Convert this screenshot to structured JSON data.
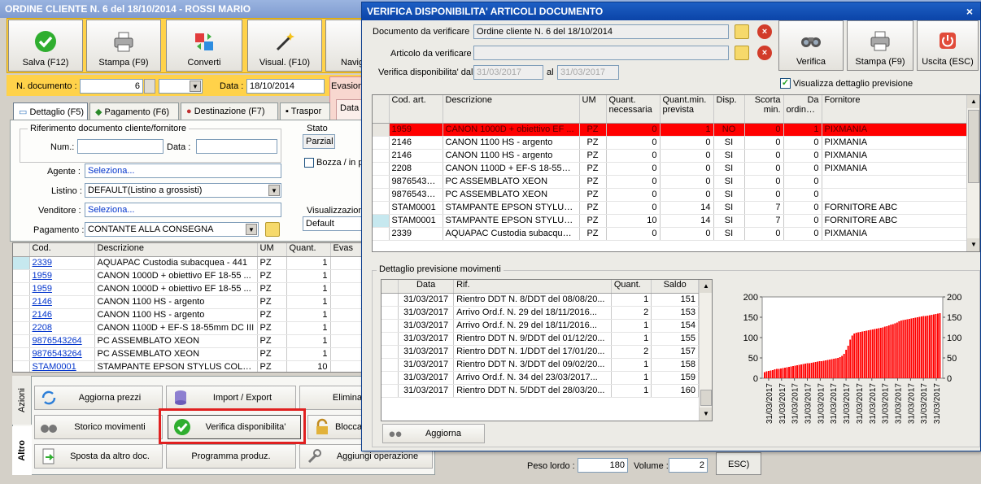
{
  "bg_window": {
    "title": "ORDINE CLIENTE N. 6 del 18/10/2014 - ROSSI MARIO",
    "toolbar": [
      "Salva (F12)",
      "Stampa (F9)",
      "Converti",
      "Visual. (F10)",
      "Navig"
    ],
    "ndoc_label": "N. documento :",
    "ndoc_value": "6",
    "data_label": "Data :",
    "data_value": "18/10/2014",
    "evasion_label": "Evasion",
    "tabs": [
      "Dettaglio (F5)",
      "Pagamento (F6)",
      "Destinazione (F7)",
      "Traspor"
    ],
    "rif_group": "Riferimento documento cliente/fornitore",
    "num_label": "Num.:",
    "data2_label": "Data :",
    "stato_label": "Stato",
    "stato_value": "Parzial",
    "bozza_label": "Bozza / in p",
    "data_box": "Data",
    "agente_label": "Agente :",
    "agente_value": "Seleziona...",
    "listino_label": "Listino :",
    "listino_value": "DEFAULT(Listino a grossisti)",
    "venditore_label": "Venditore :",
    "venditore_value": "Seleziona...",
    "pagamento_label": "Pagamento :",
    "pagamento_value": "CONTANTE ALLA CONSEGNA",
    "visual_label": "Visualizzazione",
    "visual_value": "Default",
    "grid_headers": [
      "Cod.",
      "Descrizione",
      "UM",
      "Quant.",
      "Evas"
    ],
    "grid_rows": [
      [
        "2339",
        "AQUAPAC Custodia subacquea - 441",
        "PZ",
        "1"
      ],
      [
        "1959",
        "CANON 1000D + obiettivo EF 18-55 ...",
        "PZ",
        "1"
      ],
      [
        "1959",
        "CANON 1000D + obiettivo EF 18-55 ...",
        "PZ",
        "1"
      ],
      [
        "2146",
        "CANON 1100 HS - argento",
        "PZ",
        "1"
      ],
      [
        "2146",
        "CANON 1100 HS - argento",
        "PZ",
        "1"
      ],
      [
        "2208",
        "CANON 1100D + EF-S 18-55mm DC III",
        "PZ",
        "1"
      ],
      [
        "9876543264",
        "PC ASSEMBLATO XEON",
        "PZ",
        "1"
      ],
      [
        "9876543264",
        "PC ASSEMBLATO XEON",
        "PZ",
        "1"
      ],
      [
        "STAM0001",
        "STAMPANTE EPSON STYLUS COLOR C...",
        "PZ",
        "10"
      ]
    ],
    "side_tabs": [
      "Azioni",
      "Altro"
    ],
    "actions": [
      "Aggiorna prezzi",
      "Import / Export",
      "Elimina",
      "Storico movimenti",
      "Verifica disponibilita'",
      "Blocca",
      "Sposta da altro doc.",
      "Programma produz.",
      "Aggiungi operazione"
    ],
    "peso_label": "Peso lordo :",
    "peso_value": "180",
    "volume_label": "Volume :",
    "volume_value": "2",
    "esc_fragment": "ESC)"
  },
  "dialog": {
    "title": "VERIFICA DISPONIBILITA' ARTICOLI DOCUMENTO",
    "close": "×",
    "doc_label": "Documento da verificare",
    "doc_value": "Ordine cliente N. 6 del 18/10/2014",
    "art_label": "Articolo da verificare",
    "art_value": "",
    "disp_label": "Verifica disponibilita' dal",
    "date_from": "31/03/2017",
    "al_label": "al",
    "date_to": "31/03/2017",
    "buttons": [
      "Verifica",
      "Stampa (F9)",
      "Uscita (ESC)"
    ],
    "checkbox_label": "Visualizza dettaglio previsione",
    "checkbox_checked": true,
    "headers": [
      "Cod. art.",
      "Descrizione",
      "UM",
      "Quant. necessaria",
      "Quant.min. prevista",
      "Disp.",
      "Scorta min.",
      "Da ordinare",
      "Fornitore"
    ],
    "rows": [
      [
        "1959",
        "CANON 1000D + obiettivo EF ...",
        "PZ",
        "0",
        "1",
        "NO",
        "0",
        "1",
        "PIXMANIA"
      ],
      [
        "2146",
        "CANON 1100 HS - argento",
        "PZ",
        "0",
        "0",
        "SI",
        "0",
        "0",
        "PIXMANIA"
      ],
      [
        "2146",
        "CANON 1100 HS - argento",
        "PZ",
        "0",
        "0",
        "SI",
        "0",
        "0",
        "PIXMANIA"
      ],
      [
        "2208",
        "CANON 1100D + EF-S 18-55m...",
        "PZ",
        "0",
        "0",
        "SI",
        "0",
        "0",
        "PIXMANIA"
      ],
      [
        "9876543264",
        "PC ASSEMBLATO XEON",
        "PZ",
        "0",
        "0",
        "SI",
        "0",
        "0",
        ""
      ],
      [
        "9876543264",
        "PC ASSEMBLATO XEON",
        "PZ",
        "0",
        "0",
        "SI",
        "0",
        "0",
        ""
      ],
      [
        "STAM0001",
        "STAMPANTE EPSON STYLUS C...",
        "PZ",
        "0",
        "14",
        "SI",
        "7",
        "0",
        "FORNITORE ABC"
      ],
      [
        "STAM0001",
        "STAMPANTE EPSON STYLUS C...",
        "PZ",
        "10",
        "14",
        "SI",
        "7",
        "0",
        "FORNITORE ABC"
      ],
      [
        "2339",
        "AQUAPAC Custodia subacquea...",
        "PZ",
        "0",
        "0",
        "SI",
        "0",
        "0",
        "PIXMANIA"
      ]
    ],
    "detail_group": "Dettaglio previsione movimenti",
    "detail_headers": [
      "Data",
      "Rif.",
      "Quant.",
      "Saldo"
    ],
    "detail_rows": [
      [
        "31/03/2017",
        "Rientro DDT N. 8/DDT del 08/08/20...",
        "1",
        "151"
      ],
      [
        "31/03/2017",
        "Arrivo Ord.f. N. 29 del 18/11/2016...",
        "2",
        "153"
      ],
      [
        "31/03/2017",
        "Arrivo Ord.f. N. 29 del 18/11/2016...",
        "1",
        "154"
      ],
      [
        "31/03/2017",
        "Rientro DDT N. 9/DDT del 01/12/20...",
        "1",
        "155"
      ],
      [
        "31/03/2017",
        "Rientro DDT N. 1/DDT del 17/01/20...",
        "2",
        "157"
      ],
      [
        "31/03/2017",
        "Rientro DDT N. 3/DDT del 09/02/20...",
        "1",
        "158"
      ],
      [
        "31/03/2017",
        "Arrivo Ord.f. N. 34 del 23/03/2017...",
        "1",
        "159"
      ],
      [
        "31/03/2017",
        "Rientro DDT N. 5/DDT del 28/03/20...",
        "1",
        "160"
      ]
    ],
    "aggiorna": "Aggiorna"
  },
  "chart_data": {
    "type": "bar",
    "series_color": "#ff0000",
    "ylim": [
      0,
      200
    ],
    "yticks": [
      "0",
      "50",
      "100",
      "150",
      "200"
    ],
    "xtick_label": "31/03/2017",
    "xtick_count": 14,
    "values": [
      15,
      17,
      18,
      19,
      20,
      22,
      23,
      23,
      24,
      25,
      26,
      27,
      28,
      29,
      30,
      31,
      32,
      33,
      34,
      35,
      36,
      37,
      37,
      38,
      39,
      40,
      41,
      42,
      42,
      43,
      44,
      45,
      46,
      47,
      48,
      49,
      50,
      52,
      55,
      60,
      70,
      80,
      95,
      105,
      110,
      112,
      113,
      114,
      115,
      116,
      117,
      118,
      119,
      120,
      121,
      122,
      123,
      124,
      125,
      127,
      128,
      130,
      132,
      133,
      135,
      137,
      140,
      142,
      143,
      144,
      145,
      146,
      147,
      148,
      149,
      150,
      151,
      152,
      153,
      153,
      154,
      155,
      156,
      157,
      158,
      159,
      160
    ]
  }
}
